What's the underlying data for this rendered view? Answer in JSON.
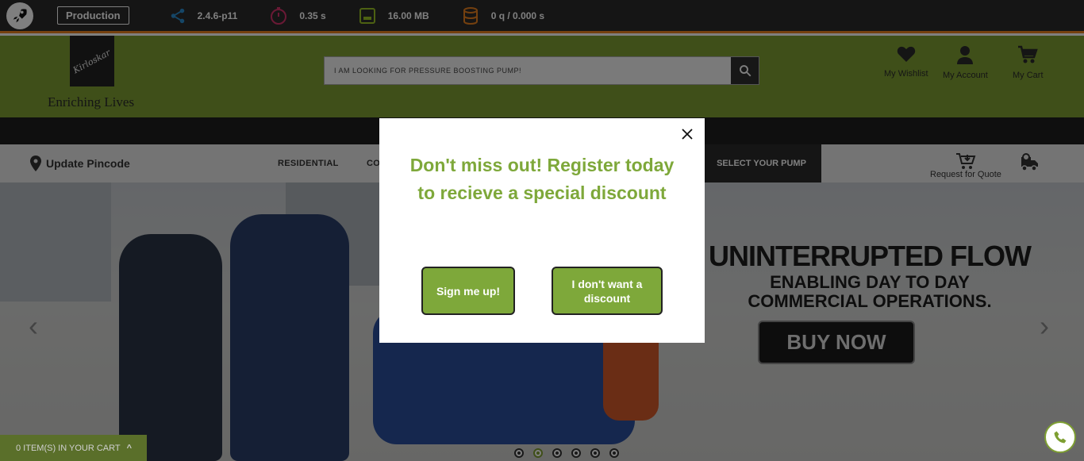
{
  "debugbar": {
    "environment": "Production",
    "version": "2.4.6-p11",
    "time": "0.35 s",
    "memory": "16.00 MB",
    "queries": "0 q / 0.000 s"
  },
  "header": {
    "logo_text": "Kirloskar",
    "tagline": "Enriching Lives",
    "search_value": "I AM LOOKING FOR PRESSURE BOOSTING PUMP!",
    "wishlist": "My Wishlist",
    "account": "My Account",
    "cart": "My Cart"
  },
  "nav": {
    "pincode": "Update Pincode",
    "residential": "RESIDENTIAL",
    "commercial_partial": "CO",
    "select_pump": "SELECT YOUR PUMP",
    "request_quote": "Request for Quote"
  },
  "banner": {
    "headline": "UNINTERRUPTED FLOW",
    "sub1": "ENABLING DAY TO DAY",
    "sub2": "COMMERCIAL OPERATIONS.",
    "cta": "BUY NOW",
    "prev": "‹",
    "next": "›",
    "slide_count": 6,
    "active_slide": 2
  },
  "cart_bar": {
    "label": "0 ITEM(S) IN YOUR CART",
    "chevron": "^"
  },
  "modal": {
    "title": "Don't miss out! Register today to recieve a special discount",
    "signup": "Sign me up!",
    "decline": "I don't want a discount"
  },
  "colors": {
    "brand_green": "#7e9f32",
    "modal_green": "#7ea83a",
    "debug_accent": "#e8801e"
  }
}
